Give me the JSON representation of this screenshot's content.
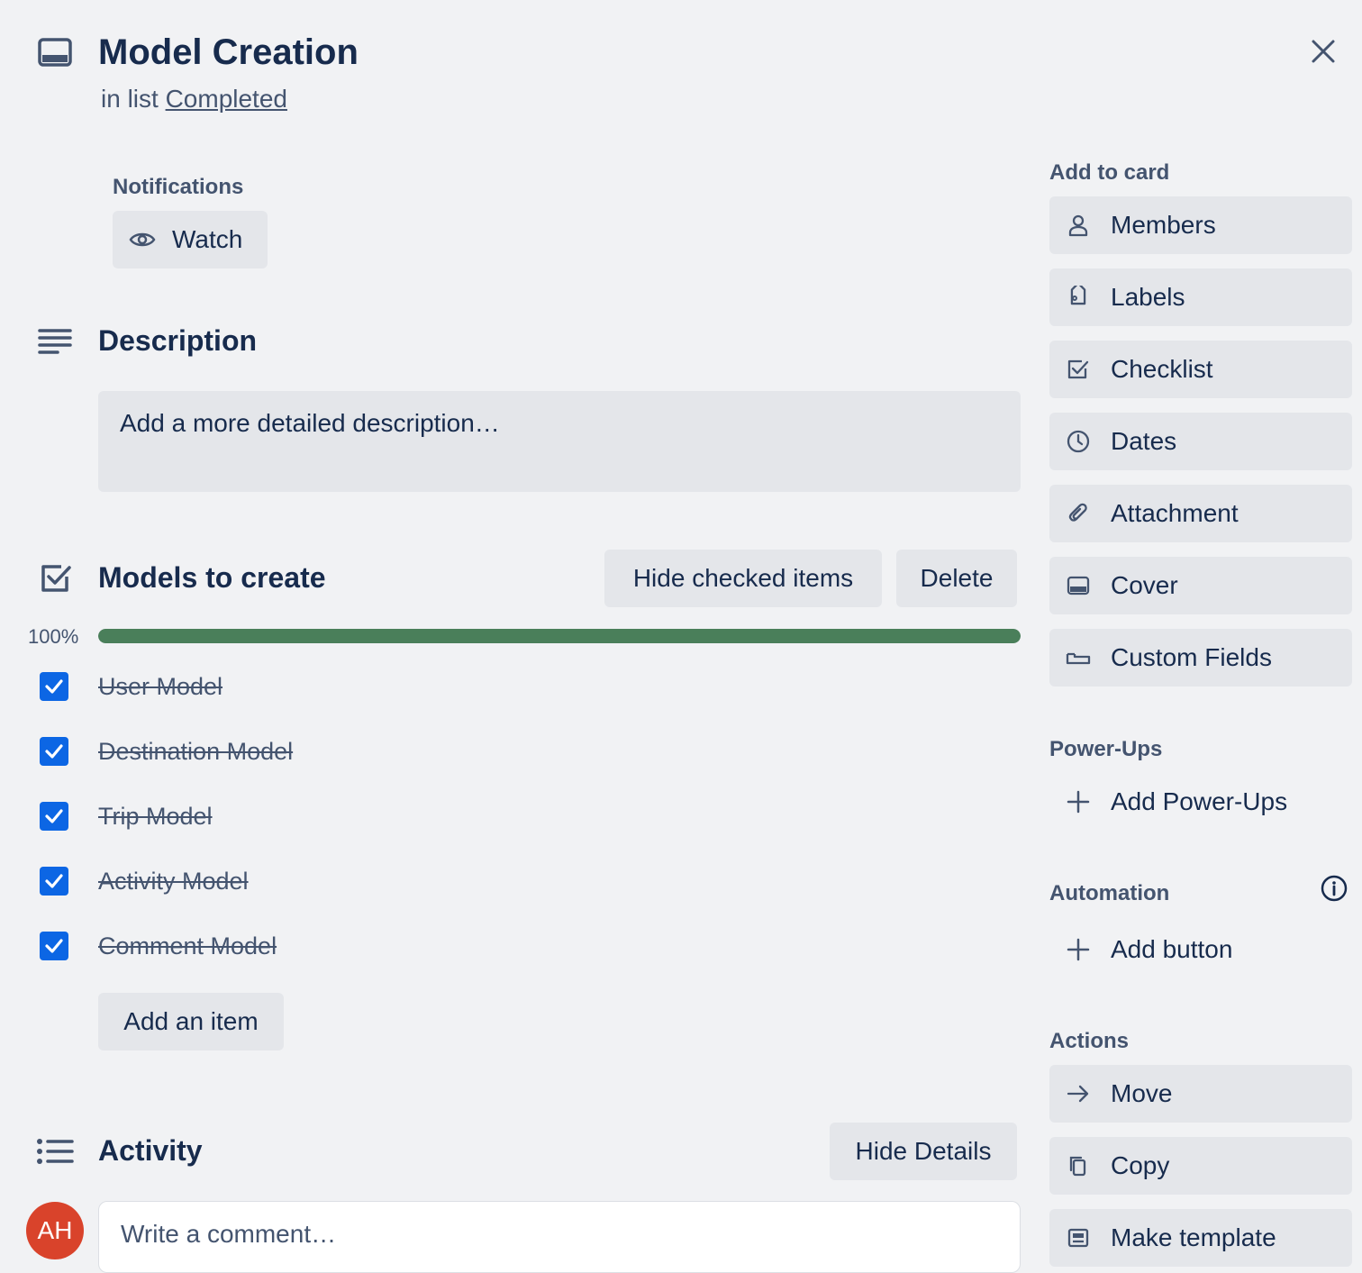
{
  "card": {
    "title": "Model Creation",
    "list_prefix": "in list",
    "list_name": "Completed"
  },
  "notifications": {
    "label": "Notifications",
    "watch_label": "Watch"
  },
  "description": {
    "heading": "Description",
    "placeholder": "Add a more detailed description…"
  },
  "checklist": {
    "heading": "Models to create",
    "hide_checked_label": "Hide checked items",
    "delete_label": "Delete",
    "progress_text": "100%",
    "progress": 1.0,
    "items": [
      {
        "label": "User Model",
        "checked": true
      },
      {
        "label": "Destination Model",
        "checked": true
      },
      {
        "label": "Trip Model",
        "checked": true
      },
      {
        "label": "Activity Model",
        "checked": true
      },
      {
        "label": "Comment Model",
        "checked": true
      }
    ],
    "add_item_label": "Add an item"
  },
  "activity": {
    "heading": "Activity",
    "hide_details_label": "Hide Details",
    "comment_placeholder": "Write a comment…",
    "avatar_initials": "AH"
  },
  "sidebar": {
    "add_to_card_label": "Add to card",
    "add_to_card": [
      {
        "label": "Members",
        "icon": "person-icon"
      },
      {
        "label": "Labels",
        "icon": "tag-icon"
      },
      {
        "label": "Checklist",
        "icon": "checklist-icon"
      },
      {
        "label": "Dates",
        "icon": "clock-icon"
      },
      {
        "label": "Attachment",
        "icon": "paperclip-icon"
      },
      {
        "label": "Cover",
        "icon": "cover-icon"
      },
      {
        "label": "Custom Fields",
        "icon": "custom-fields-icon"
      }
    ],
    "powerups_label": "Power-Ups",
    "add_powerups_label": "Add Power-Ups",
    "automation_label": "Automation",
    "add_button_label": "Add button",
    "actions_label": "Actions",
    "actions": [
      {
        "label": "Move",
        "icon": "arrow-right-icon"
      },
      {
        "label": "Copy",
        "icon": "copy-icon"
      },
      {
        "label": "Make template",
        "icon": "template-icon"
      }
    ]
  },
  "colors": {
    "background": "#f1f2f4",
    "button": "#e4e6ea",
    "progress": "#4a7f5a",
    "checkbox": "#0c66e4",
    "avatar": "#d9432b"
  }
}
